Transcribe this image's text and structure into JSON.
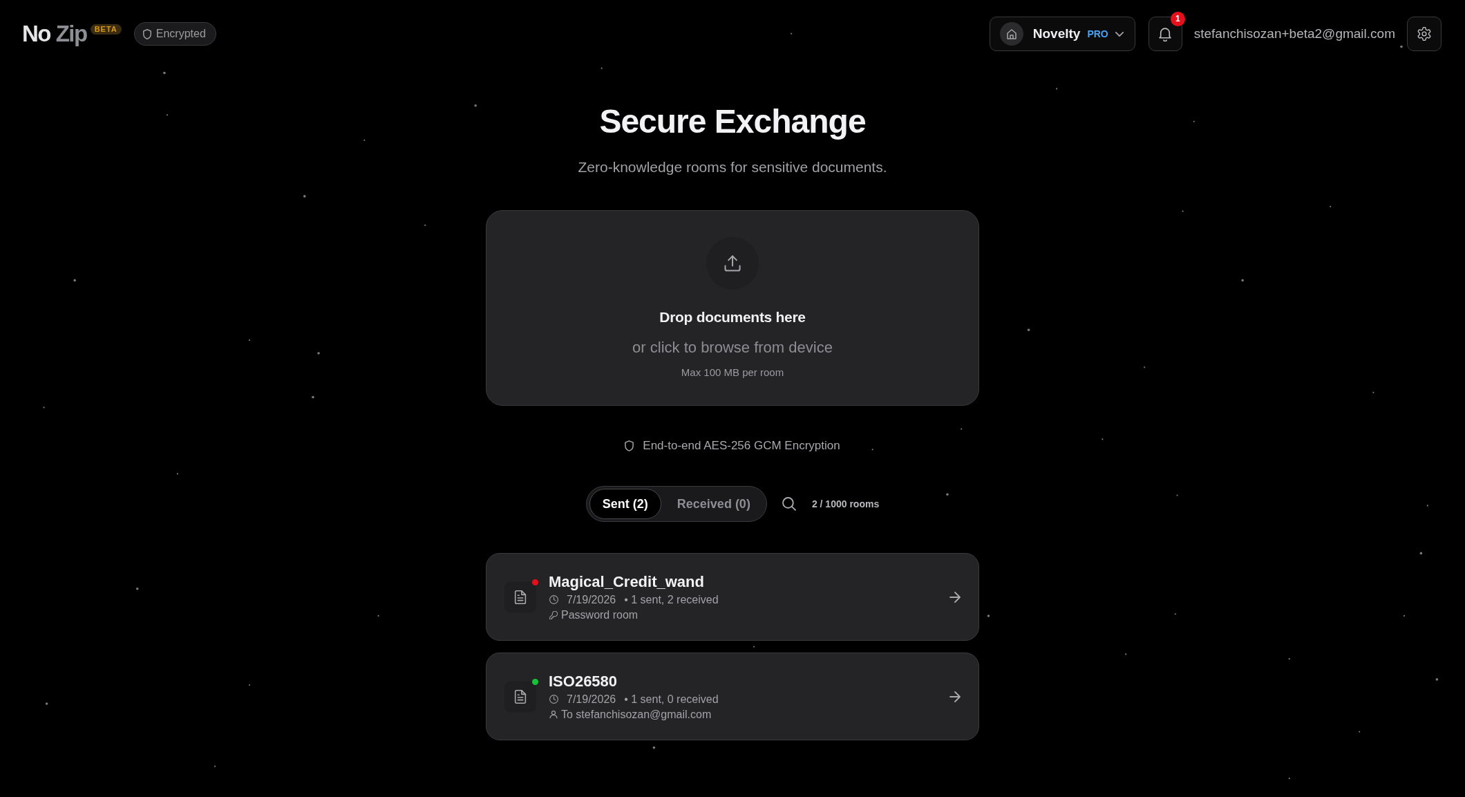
{
  "header": {
    "logo": [
      "No",
      "Zip"
    ],
    "beta_badge": "BETA",
    "status_pill": "Encrypted",
    "workspace": {
      "name": "Novelty",
      "plan": "PRO"
    },
    "notifications": {
      "count": "1"
    },
    "user_email": "stefanchisozan+beta2@gmail.com"
  },
  "hero": {
    "title": "Secure Exchange",
    "subtitle": "Zero-knowledge rooms for sensitive documents."
  },
  "dropzone": {
    "title": "Drop documents here",
    "subtitle": "or click to browse from device",
    "limit": "Max 100 MB per room"
  },
  "encryption_note": "End-to-end AES-256 GCM Encryption",
  "tabs": [
    {
      "label": "Sent (2)",
      "selected": true
    },
    {
      "label": "Received (0)",
      "selected": false
    }
  ],
  "room_count": "2 / 1000 rooms",
  "rooms": [
    {
      "name": "Magical_Credit_wand",
      "color": "#e5101b",
      "date": "7/19/2026",
      "stats": "• 1 sent, 2 received",
      "kind": "password",
      "detail": "Password room"
    },
    {
      "name": "ISO26580",
      "color": "#16c23a",
      "date": "7/19/2026",
      "stats": "• 1 sent, 0 received",
      "kind": "recipient",
      "detail": "To stefanchisozan@gmail.com"
    }
  ]
}
